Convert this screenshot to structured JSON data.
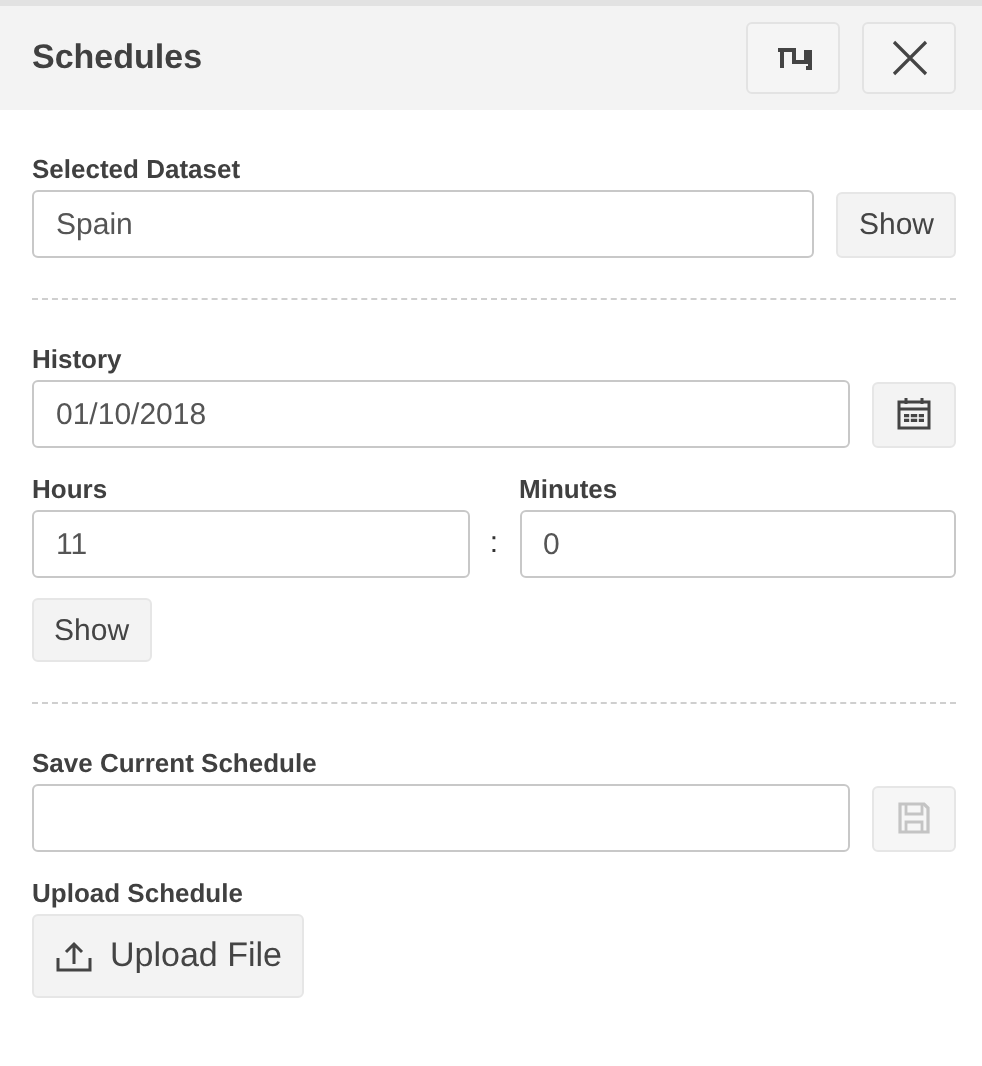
{
  "header": {
    "title": "Schedules"
  },
  "dataset": {
    "label": "Selected Dataset",
    "value": "Spain",
    "button": "Show"
  },
  "history": {
    "label": "History",
    "date": "01/10/2018",
    "hours_label": "Hours",
    "hours": "11",
    "separator": ":",
    "minutes_label": "Minutes",
    "minutes": "0",
    "button": "Show"
  },
  "save": {
    "label": "Save Current Schedule",
    "disabled": true
  },
  "upload": {
    "label": "Upload Schedule",
    "button": "Upload File"
  }
}
